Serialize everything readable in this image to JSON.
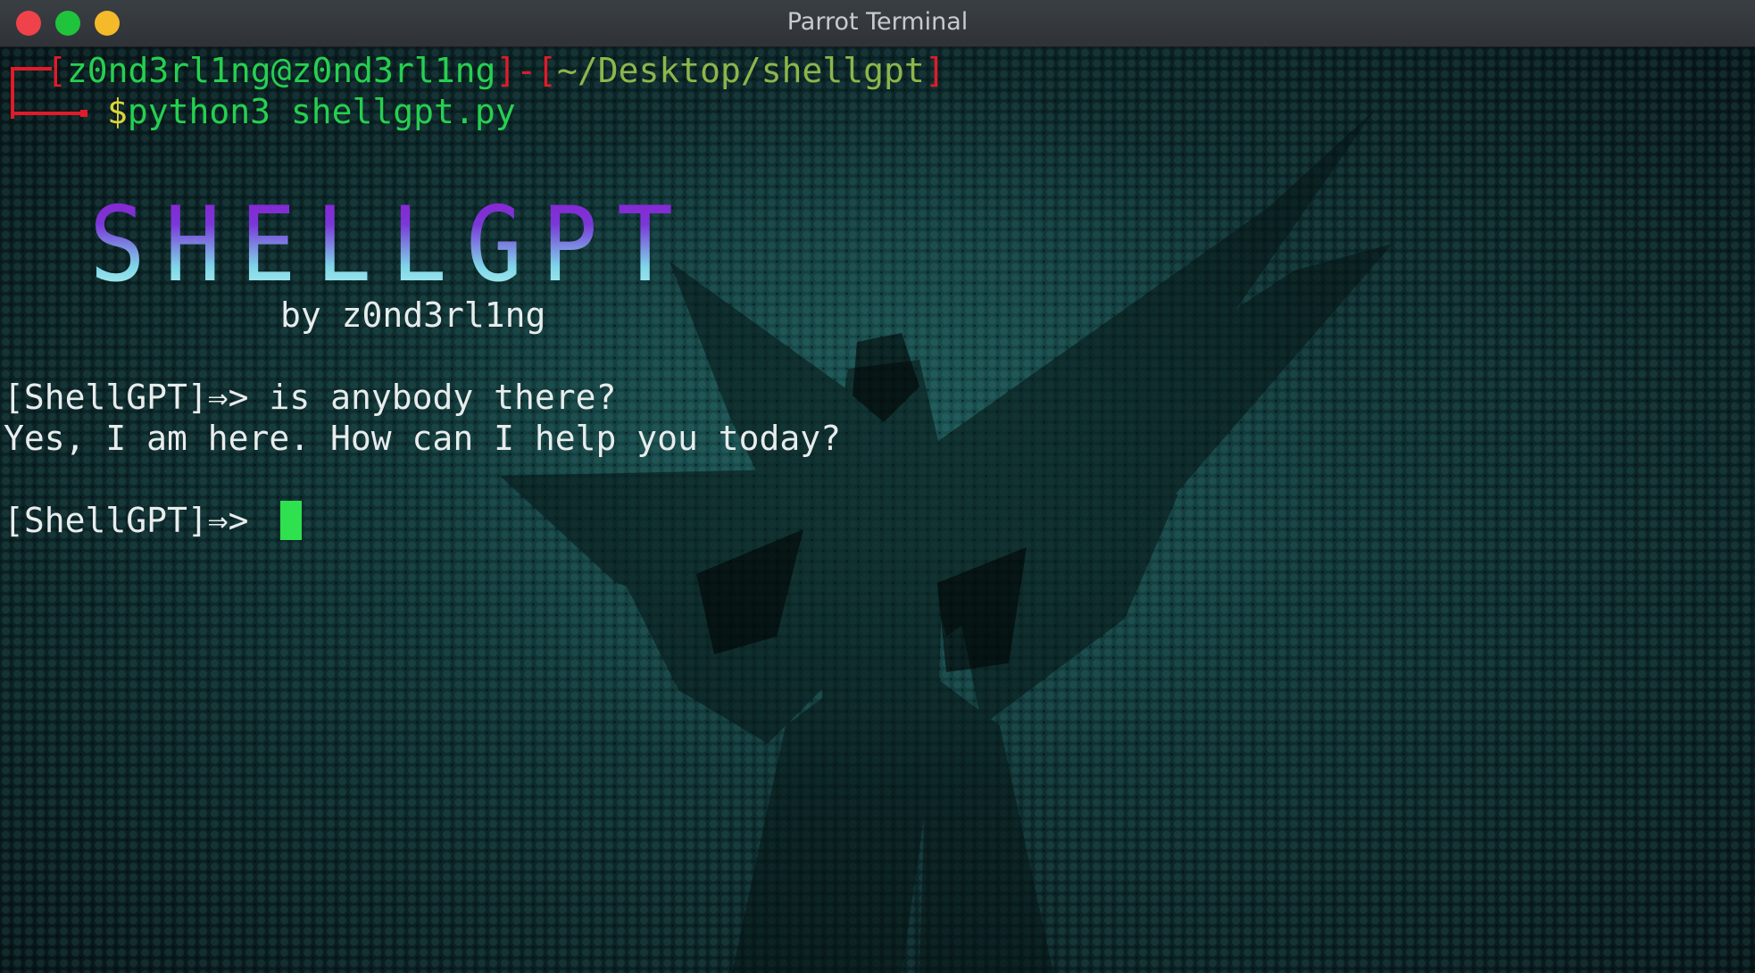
{
  "window": {
    "title": "Parrot Terminal",
    "buttons": [
      "close",
      "maximize",
      "minimize"
    ]
  },
  "prompt": {
    "bracket_open": "[",
    "user_host": "z0nd3rl1ng@z0nd3rl1ng",
    "bracket_close": "]",
    "dash": "-",
    "cwd_open": "[",
    "cwd": "~/Desktop/shellgpt",
    "cwd_close": "]",
    "dollar": "$",
    "command": "python3 shellgpt.py"
  },
  "banner": {
    "title": "SHELLGPT",
    "byline": "by z0nd3rl1ng"
  },
  "session": [
    {
      "prompt": "[ShellGPT]⇒>",
      "input": "is anybody there?"
    },
    {
      "output": "Yes, I am here. How can I help you today?"
    }
  ],
  "current_prompt": "[ShellGPT]⇒>",
  "colors": {
    "prompt_green": "#26d04f",
    "bracket_red": "#e11b29",
    "cursor": "#2fe04f",
    "background": "#0d2b2d"
  }
}
